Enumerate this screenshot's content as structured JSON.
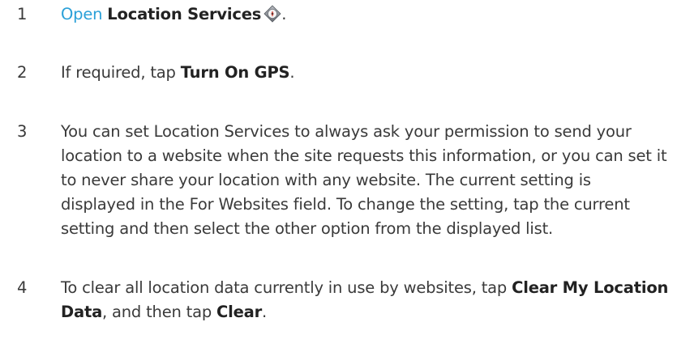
{
  "steps": [
    {
      "number": "1",
      "link_text": "Open",
      "app_name": "Location Services",
      "app_icon": "location-services-icon",
      "end": "."
    },
    {
      "number": "2",
      "text_before": "If required, tap ",
      "bold": "Turn On GPS",
      "end": "."
    },
    {
      "number": "3",
      "text": "You can set Location Services to always ask your permission to send your location to a website when the site requests this information, or you can set it to never share your location with any website. The current setting is displayed in the For Websites field. To change the setting, tap the current setting and then select the other option from the displayed list."
    },
    {
      "number": "4",
      "text_before": "To clear all location data currently in use by websites, tap ",
      "bold_1": "Clear My Location Data",
      "text_middle": ", and then tap ",
      "bold_2": "Clear",
      "end": "."
    }
  ],
  "colors": {
    "text": "#3a3a3a",
    "link": "#2aa0d8",
    "bold": "#222222"
  }
}
